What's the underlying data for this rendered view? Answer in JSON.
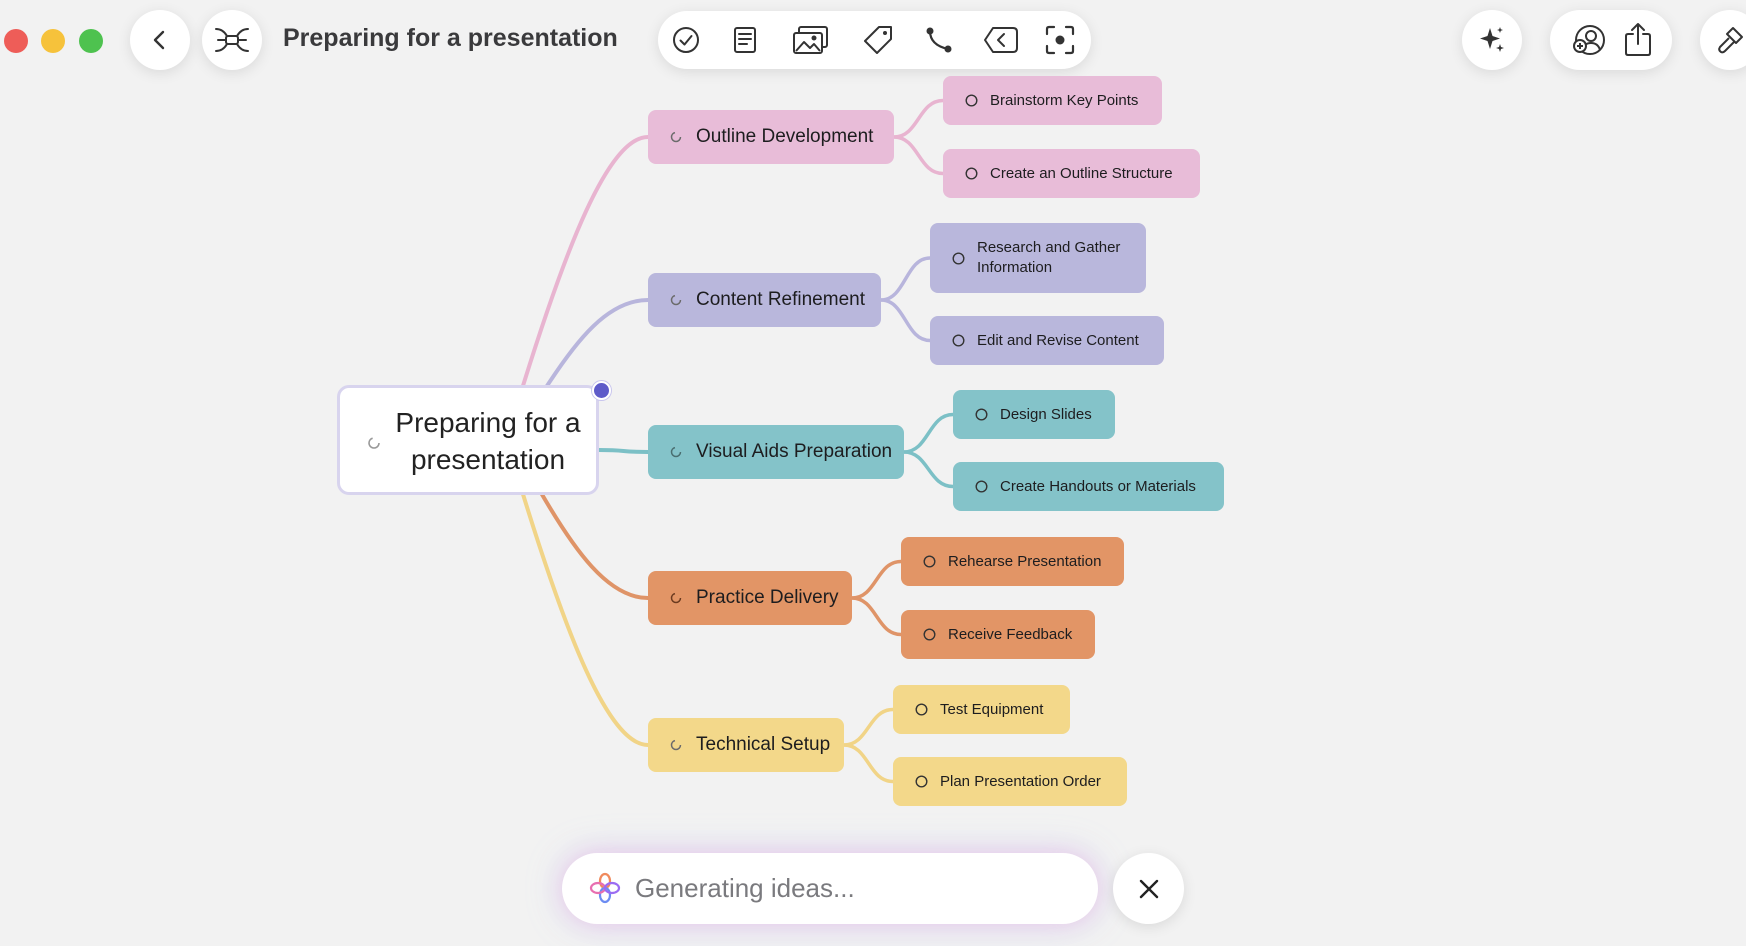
{
  "window": {
    "title": "Preparing for a presentation"
  },
  "toolbar": {
    "tools": [
      "task-icon",
      "note-icon",
      "image-icon",
      "tag-icon",
      "relationship-icon",
      "boundary-icon",
      "focus-icon"
    ]
  },
  "right_actions": [
    "ai-sparkle-icon",
    "collaborate-icon",
    "share-icon",
    "format-icon"
  ],
  "mindmap": {
    "root": "Preparing for a presentation",
    "branches": [
      {
        "label": "Outline Development",
        "color": "#e8bcd8",
        "line": "#e8b4d0",
        "children": [
          "Brainstorm Key Points",
          "Create an Outline Structure"
        ]
      },
      {
        "label": "Content Refinement",
        "color": "#b9b7dc",
        "line": "#b8b5dc",
        "children": [
          "Research and Gather Information",
          "Edit and Revise Content"
        ]
      },
      {
        "label": "Visual Aids Preparation",
        "color": "#84c3c9",
        "line": "#7cc0c6",
        "children": [
          "Design Slides",
          "Create Handouts or Materials"
        ]
      },
      {
        "label": "Practice Delivery",
        "color": "#e29566",
        "line": "#df9468",
        "children": [
          "Rehearse Presentation",
          "Receive Feedback"
        ]
      },
      {
        "label": "Technical Setup",
        "color": "#f3d88a",
        "line": "#f1d487",
        "children": [
          "Test Equipment",
          "Plan Presentation Order"
        ]
      }
    ]
  },
  "ai_status": {
    "text": "Generating ideas..."
  }
}
